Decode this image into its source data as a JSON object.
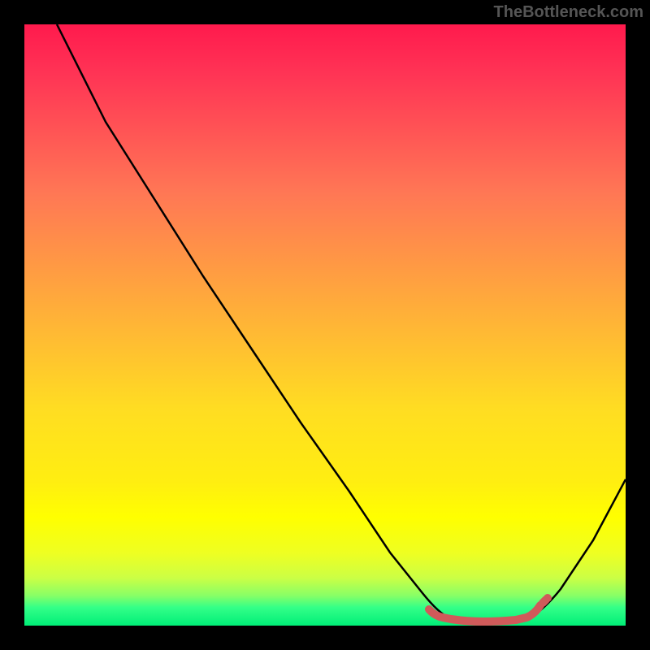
{
  "watermark": "TheBottleneck.com",
  "chart_data": {
    "type": "line",
    "title": "",
    "xlabel": "",
    "ylabel": "",
    "xlim": [
      0,
      100
    ],
    "ylim": [
      0,
      100
    ],
    "series": [
      {
        "name": "bottleneck-curve",
        "x": [
          0,
          5,
          10,
          15,
          20,
          25,
          30,
          35,
          40,
          45,
          50,
          55,
          60,
          65,
          68,
          70,
          73,
          76,
          79,
          82,
          85,
          88,
          91,
          94,
          97,
          100
        ],
        "y": [
          100,
          96,
          92,
          87,
          81,
          74,
          66,
          58,
          50,
          42,
          34,
          26,
          18,
          11,
          7,
          4,
          2,
          1,
          0.5,
          0.5,
          1,
          3,
          7,
          12,
          18,
          25
        ]
      },
      {
        "name": "optimal-marker",
        "x": [
          68,
          70,
          72,
          74,
          76,
          78,
          80,
          82,
          84,
          86
        ],
        "y": [
          3,
          2,
          1.5,
          1,
          1,
          1,
          1,
          1.5,
          2,
          3
        ]
      }
    ],
    "gradient_stops": [
      {
        "pos": 0,
        "color": "#ff1a4d"
      },
      {
        "pos": 50,
        "color": "#ffaa33"
      },
      {
        "pos": 85,
        "color": "#ffff00"
      },
      {
        "pos": 100,
        "color": "#00ee77"
      }
    ]
  }
}
